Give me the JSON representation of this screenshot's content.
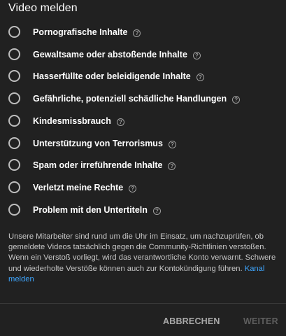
{
  "dialog": {
    "title": "Video melden",
    "options": [
      {
        "label": "Pornografische Inhalte"
      },
      {
        "label": "Gewaltsame oder abstoßende Inhalte"
      },
      {
        "label": "Hasserfüllte oder beleidigende Inhalte"
      },
      {
        "label": "Gefährliche, potenziell schädliche Handlungen"
      },
      {
        "label": "Kindesmissbrauch"
      },
      {
        "label": "Unterstützung von Terrorismus"
      },
      {
        "label": "Spam oder irreführende Inhalte"
      },
      {
        "label": "Verletzt meine Rechte"
      },
      {
        "label": "Problem mit den Untertiteln"
      }
    ],
    "help_icon": "help-circle-icon",
    "info_text": "Unsere Mitarbeiter sind rund um die Uhr im Einsatz, um nachzuprüfen, ob gemeldete Videos tatsächlich gegen die Community-Richtlinien verstoßen. Wenn ein Verstoß vorliegt, wird das verantwortliche Konto verwarnt. Schwere und wiederholte Verstöße können auch zur Kontokündigung führen.",
    "info_link": "Kanal melden",
    "cancel_label": "ABBRECHEN",
    "next_label": "WEITER"
  },
  "colors": {
    "background": "#212121",
    "link": "#3ea6ff",
    "text_secondary": "#c6c6c6",
    "button_disabled": "#5e5e5e"
  }
}
